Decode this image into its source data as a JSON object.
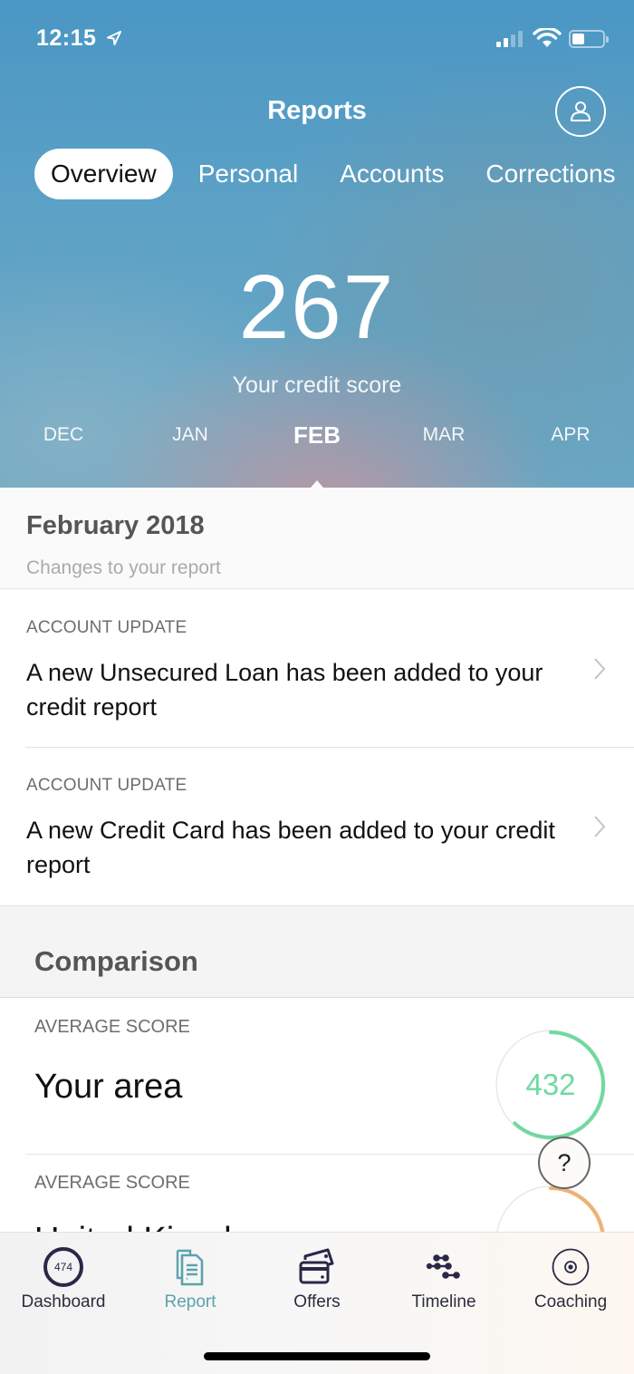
{
  "status_bar": {
    "time": "12:15",
    "signal_bars_active": 2,
    "signal_bars_total": 4,
    "battery_percent": 35
  },
  "header": {
    "title": "Reports",
    "profile_icon": "person-icon"
  },
  "tabs": [
    {
      "label": "Overview",
      "active": true
    },
    {
      "label": "Personal",
      "active": false
    },
    {
      "label": "Accounts",
      "active": false
    },
    {
      "label": "Corrections",
      "active": false
    }
  ],
  "score": {
    "value": "267",
    "label": "Your credit score"
  },
  "months": [
    {
      "label": "DEC",
      "active": false
    },
    {
      "label": "JAN",
      "active": false
    },
    {
      "label": "FEB",
      "active": true
    },
    {
      "label": "MAR",
      "active": false
    },
    {
      "label": "APR",
      "active": false
    }
  ],
  "changes": {
    "title": "February 2018",
    "subtitle": "Changes to your report",
    "items": [
      {
        "kicker": "ACCOUNT UPDATE",
        "text": "A new Unsecured Loan has been added to your credit report"
      },
      {
        "kicker": "ACCOUNT UPDATE",
        "text": "A new Credit Card has been added to your credit report"
      }
    ]
  },
  "comparison": {
    "title": "Comparison",
    "items": [
      {
        "kicker": "AVERAGE SCORE",
        "name": "Your area",
        "value": "432",
        "fraction": 0.62,
        "color": "#6fd9a0"
      },
      {
        "kicker": "AVERAGE SCORE",
        "name": "United Kingdom",
        "value": "",
        "fraction": 0.4,
        "color": "#f2b071"
      }
    ]
  },
  "help_button": {
    "label": "?"
  },
  "tabbar": {
    "items": [
      {
        "label": "Dashboard",
        "icon": "score-ring-icon",
        "badge": "474",
        "active": false
      },
      {
        "label": "Report",
        "icon": "report-documents-icon",
        "active": true
      },
      {
        "label": "Offers",
        "icon": "credit-cards-icon",
        "active": false
      },
      {
        "label": "Timeline",
        "icon": "timeline-icon",
        "active": false
      },
      {
        "label": "Coaching",
        "icon": "target-icon",
        "active": false
      }
    ]
  },
  "colors": {
    "accent_teal": "#5ba3ad",
    "gauge_green": "#6fd9a0",
    "gauge_orange": "#f2b071",
    "nav_dark": "#2a2847"
  }
}
